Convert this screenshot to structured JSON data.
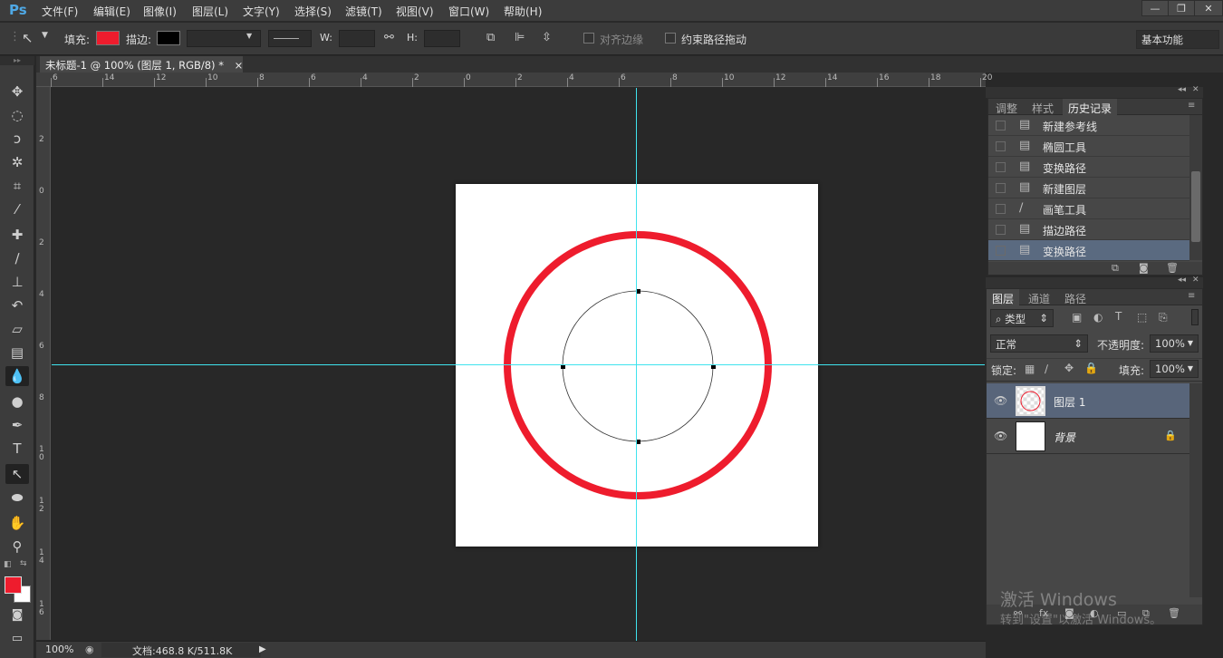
{
  "app": {
    "logo": "Ps"
  },
  "menu": [
    "文件(F)",
    "编辑(E)",
    "图像(I)",
    "图层(L)",
    "文字(Y)",
    "选择(S)",
    "滤镜(T)",
    "视图(V)",
    "窗口(W)",
    "帮助(H)"
  ],
  "window_controls": {
    "minimize": "—",
    "restore": "❐",
    "close": "✕"
  },
  "options": {
    "fill_label": "填充:",
    "stroke_label": "描边:",
    "w_label": "W:",
    "h_label": "H:",
    "align_edges": "对齐边缘",
    "constrain_path": "约束路径拖动",
    "workspace": "基本功能",
    "fill_color": "#ee1c2d",
    "stroke_color": "#000000"
  },
  "document_tab": {
    "title": "未标题-1 @ 100% (图层 1, RGB/8) *",
    "close": "×"
  },
  "ruler_top": [
    "6",
    "14",
    "12",
    "10",
    "8",
    "6",
    "4",
    "2",
    "0",
    "2",
    "4",
    "6",
    "8",
    "10",
    "12",
    "14",
    "16",
    "18",
    "20"
  ],
  "ruler_left": [
    "2",
    "0",
    "2",
    "4",
    "6",
    "8",
    "1 0",
    "1 2",
    "1 4",
    "1 6"
  ],
  "status": {
    "zoom": "100%",
    "doc": "文档:468.8 K/511.8K"
  },
  "history": {
    "tabs": [
      "调整",
      "样式",
      "历史记录"
    ],
    "items": [
      {
        "label": "新建参考线",
        "icon": "doc-icon"
      },
      {
        "label": "椭圆工具",
        "icon": "doc-icon"
      },
      {
        "label": "变换路径",
        "icon": "doc-icon"
      },
      {
        "label": "新建图层",
        "icon": "doc-icon"
      },
      {
        "label": "画笔工具",
        "icon": "brush-icon"
      },
      {
        "label": "描边路径",
        "icon": "doc-icon"
      },
      {
        "label": "变换路径",
        "icon": "doc-icon"
      }
    ]
  },
  "layers": {
    "tabs": [
      "图层",
      "通道",
      "路径"
    ],
    "kind": "类型",
    "blend_mode": "正常",
    "opacity_label": "不透明度:",
    "opacity": "100%",
    "lock_label": "锁定:",
    "fill_label": "填充:",
    "fill": "100%",
    "items": [
      {
        "name": "图层 1",
        "selected": true
      },
      {
        "name": "背景",
        "selected": false
      }
    ]
  },
  "watermark": {
    "line1": "激活 Windows",
    "line2": "转到\"设置\"以激活 Windows。"
  },
  "colors": {
    "foreground": "#ee1c2d",
    "background": "#ffffff",
    "guide": "#3fe3ee"
  }
}
